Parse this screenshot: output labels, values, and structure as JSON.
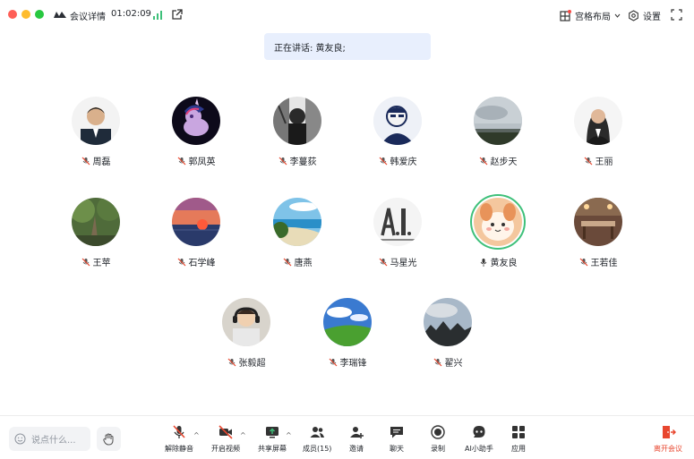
{
  "titlebar": {
    "title": "会议详情",
    "time": "01:02:09",
    "layout_label": "宫格布局",
    "settings_label": "设置"
  },
  "banner": {
    "speaking_text": "正在讲话: 黄友良;"
  },
  "participants": [
    {
      "name": "周磊",
      "muted": true
    },
    {
      "name": "郭凤英",
      "muted": true
    },
    {
      "name": "李蔓荻",
      "muted": true
    },
    {
      "name": "韩爱庆",
      "muted": true
    },
    {
      "name": "赵步天",
      "muted": true
    },
    {
      "name": "王丽",
      "muted": true
    },
    {
      "name": "王苹",
      "muted": true
    },
    {
      "name": "石学峰",
      "muted": true
    },
    {
      "name": "唐燕",
      "muted": true
    },
    {
      "name": "马星光",
      "muted": true
    },
    {
      "name": "黄友良",
      "muted": false
    },
    {
      "name": "王若佳",
      "muted": true
    },
    {
      "name": "张毅超",
      "muted": true
    },
    {
      "name": "李瑞锋",
      "muted": true
    },
    {
      "name": "翟兴",
      "muted": true
    }
  ],
  "toolbar": {
    "chat_placeholder": "说点什么...",
    "unmute": "解除静音",
    "video": "开启视频",
    "share": "共享屏幕",
    "members": "成员(15)",
    "invite": "邀请",
    "chat": "聊天",
    "record": "录制",
    "ai": "AI小助手",
    "apps": "应用",
    "leave": "离开会议"
  },
  "colors": {
    "accent_green": "#3ec07a",
    "leave_red": "#e8472f",
    "banner_bg": "#e8effd"
  }
}
